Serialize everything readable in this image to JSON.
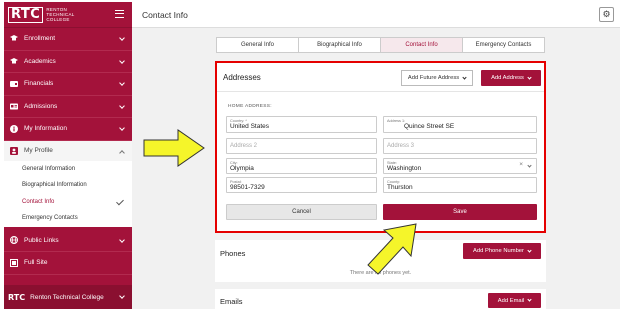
{
  "colors": {
    "brand": "#a3123a",
    "highlight": "#e50000",
    "arrow": "#f5f52a"
  },
  "sidebar": {
    "logo_text": "RTC",
    "logo_subtitle": "RENTON\nTECHNICAL\nCOLLEGE",
    "items": [
      {
        "label": "Enrollment",
        "icon": "graduation-cap-icon"
      },
      {
        "label": "Academics",
        "icon": "graduation-cap-icon"
      },
      {
        "label": "Financials",
        "icon": "wallet-icon"
      },
      {
        "label": "Admissions",
        "icon": "id-card-icon"
      },
      {
        "label": "My Information",
        "icon": "info-icon"
      }
    ],
    "profile": {
      "label": "My Profile",
      "icon": "user-box-icon",
      "sub_items": [
        {
          "label": "General Information"
        },
        {
          "label": "Biographical Information"
        },
        {
          "label": "Contact Info"
        },
        {
          "label": "Emergency Contacts"
        }
      ]
    },
    "bottom_items": [
      {
        "label": "Public Links",
        "icon": "globe-icon"
      },
      {
        "label": "Full Site",
        "icon": "full-site-icon"
      }
    ],
    "footer_logo": "RTC",
    "footer_label": "Renton Technical College"
  },
  "header": {
    "title": "Contact Info",
    "settings_icon": "gear-icon"
  },
  "tabs": [
    {
      "label": "General Info"
    },
    {
      "label": "Biographical Info"
    },
    {
      "label": "Contact Info"
    },
    {
      "label": "Emergency Contacts"
    }
  ],
  "addresses": {
    "title": "Addresses",
    "future_button": "Add Future Address",
    "add_button": "Add Address",
    "section_label": "HOME ADDRESS:",
    "country": {
      "label": "Country: *",
      "value": "United States"
    },
    "address1": {
      "label": "Address 1:",
      "value": "Quince Street SE"
    },
    "address2": {
      "placeholder": "Address 2"
    },
    "address3": {
      "placeholder": "Address 3"
    },
    "city": {
      "label": "City:",
      "value": "Olympia"
    },
    "state": {
      "label": "State:",
      "value": "Washington"
    },
    "postal": {
      "label": "Postal:",
      "value": "98501-7329"
    },
    "county": {
      "label": "County:",
      "value": "Thurston"
    },
    "cancel_button": "Cancel",
    "save_button": "Save"
  },
  "phones": {
    "title": "Phones",
    "add_button": "Add Phone Number",
    "empty_text": "There are no phones yet."
  },
  "emails": {
    "title": "Emails",
    "add_button": "Add Email"
  }
}
